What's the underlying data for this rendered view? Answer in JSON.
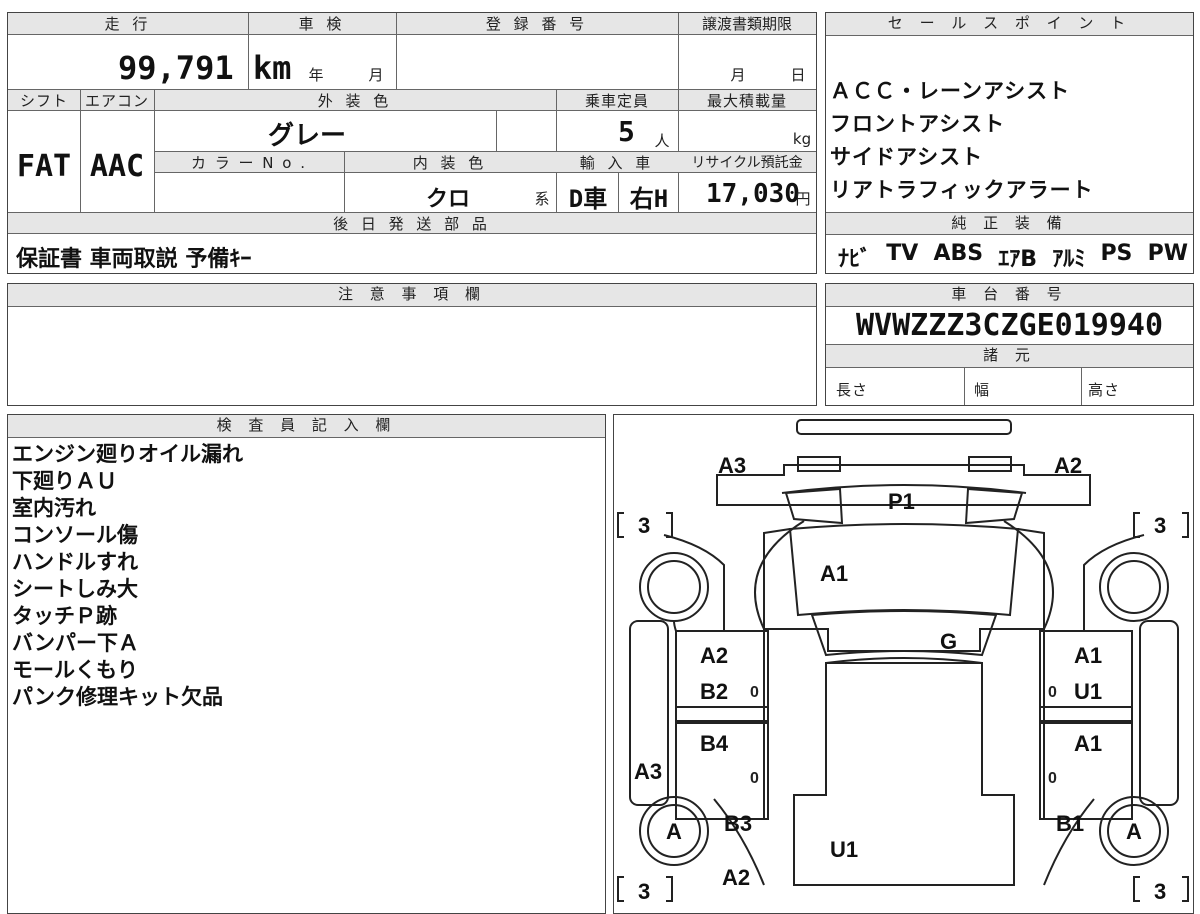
{
  "top": {
    "mileage_label": "走 行",
    "mileage_value": "99,791",
    "mileage_unit": "km",
    "shaken_label": "車 検",
    "shaken_year": "年",
    "shaken_month": "月",
    "reg_label": "登 録 番 号",
    "transfer_label": "譲渡書類期限",
    "transfer_month": "月",
    "transfer_day": "日",
    "shift_label": "シフト",
    "aircon_label": "エアコン",
    "exterior_label": "外 装 色",
    "capacity_label": "乗車定員",
    "maxload_label": "最大積載量",
    "shift_value": "FAT",
    "aircon_value": "AAC",
    "exterior_value": "グレー",
    "capacity_value": "5",
    "capacity_unit": "人",
    "maxload_unit": "kg",
    "colorno_label": "カ ラ ー N o .",
    "interior_label": "内 装 色",
    "import_label": "輸 入 車",
    "recycle_label": "リサイクル預託金",
    "interior_value": "クロ",
    "interior_suffix": "系",
    "import_d": "D車",
    "import_h": "右H",
    "recycle_value": "17,030",
    "recycle_unit": "円",
    "later_label": "後 日 発 送 部 品",
    "later_value": "保証書 車両取説 予備ｷｰ"
  },
  "sales_points": {
    "label": "セ ー ル ス ポ イ ン ト",
    "lines": [
      "ＡＣＣ・レーンアシスト",
      "フロントアシスト",
      "サイドアシスト",
      "リアトラフィックアラート"
    ]
  },
  "equipment": {
    "label": "純 正 装 備",
    "items": [
      "ﾅﾋﾞ",
      "TV",
      "ABS",
      "ｴｱB",
      "ｱﾙﾐ",
      "PS",
      "PW"
    ]
  },
  "caution": {
    "label": "注 意 事 項 欄"
  },
  "chassis": {
    "label": "車 台 番 号",
    "value": "WVWZZZ3CZGE019940",
    "spec_label": "諸 元",
    "length_label": "長さ",
    "width_label": "幅",
    "height_label": "高さ"
  },
  "inspector": {
    "label": "検 査 員 記 入 欄",
    "notes": [
      "エンジン廻りオイル漏れ",
      "下廻りＡＵ",
      "室内汚れ",
      "コンソール傷",
      "ハンドルすれ",
      "シートしみ大",
      "タッチＰ跡",
      "バンパー下Ａ",
      "モールくもり",
      "パンク修理キット欠品"
    ]
  },
  "diagram": {
    "front_left": "A3",
    "front_right": "A2",
    "front_center": "P1",
    "hood": "A1",
    "windshield": "G",
    "left_front_door_1": "A2",
    "left_front_door_2": "B2",
    "left_rear_door": "B4",
    "left_rocker": "A3",
    "right_front_door_1": "A1",
    "right_front_door_2": "U1",
    "right_rear_door": "A1",
    "left_rear_fender": "B3",
    "right_rear_fender": "B1",
    "roof": "U1",
    "rear": "A2",
    "tire_left": "A",
    "tire_right": "A",
    "bracket_3": "3",
    "zero": "0"
  }
}
